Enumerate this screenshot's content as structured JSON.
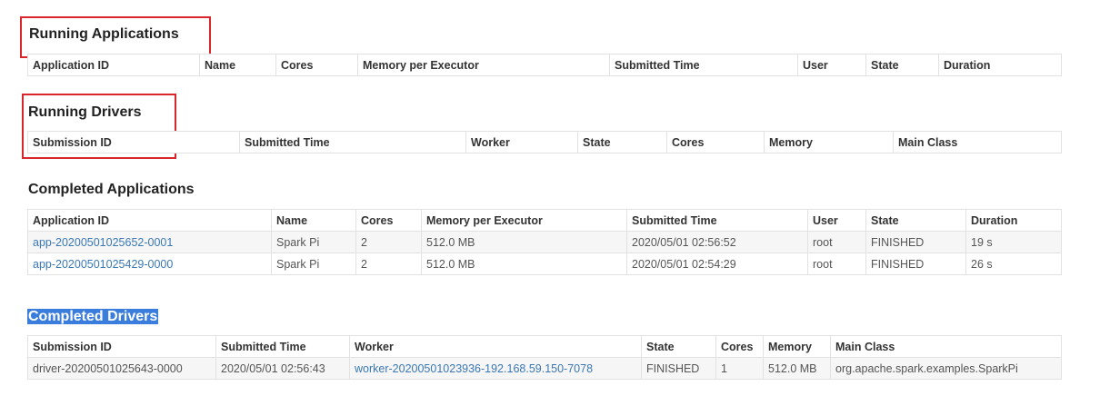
{
  "running_applications": {
    "title": "Running Applications",
    "columns": [
      "Application ID",
      "Name",
      "Cores",
      "Memory per Executor",
      "Submitted Time",
      "User",
      "State",
      "Duration"
    ]
  },
  "running_drivers": {
    "title": "Running Drivers",
    "columns": [
      "Submission ID",
      "Submitted Time",
      "Worker",
      "State",
      "Cores",
      "Memory",
      "Main Class"
    ]
  },
  "completed_applications": {
    "title": "Completed Applications",
    "columns": [
      "Application ID",
      "Name",
      "Cores",
      "Memory per Executor",
      "Submitted Time",
      "User",
      "State",
      "Duration"
    ],
    "rows": [
      [
        "app-20200501025652-0001",
        "Spark Pi",
        "2",
        "512.0 MB",
        "2020/05/01 02:56:52",
        "root",
        "FINISHED",
        "19 s"
      ],
      [
        "app-20200501025429-0000",
        "Spark Pi",
        "2",
        "512.0 MB",
        "2020/05/01 02:54:29",
        "root",
        "FINISHED",
        "26 s"
      ]
    ]
  },
  "completed_drivers": {
    "title": "Completed Drivers",
    "columns": [
      "Submission ID",
      "Submitted Time",
      "Worker",
      "State",
      "Cores",
      "Memory",
      "Main Class"
    ],
    "rows": [
      [
        "driver-20200501025643-0000",
        "2020/05/01 02:56:43",
        "worker-20200501023936-192.168.59.150-7078",
        "FINISHED",
        "1",
        "512.0 MB",
        "org.apache.spark.examples.SparkPi"
      ]
    ]
  },
  "colors": {
    "highlight_border": "#d9262c",
    "selection": "#3b7ddd",
    "link": "#3a78b5"
  }
}
